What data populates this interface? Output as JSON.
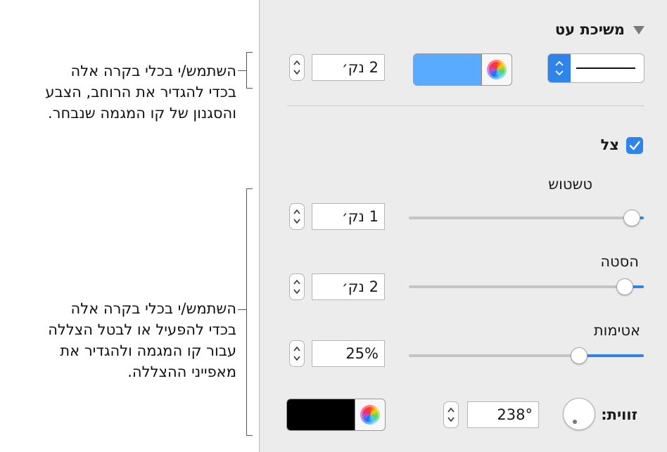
{
  "callouts": {
    "top": [
      "השתמש/י בכלי בקרה אלה",
      "בכדי להגדיר את הרוחב, הצבע",
      "והסגנון של קו המגמה שנבחר."
    ],
    "bottom": [
      "השתמש/י בכלי בקרה אלה",
      "בכדי להפעיל או לבטל הצללה",
      "עבור קו המגמה ולהגדיר את",
      "מאפייני ההצללה."
    ]
  },
  "stroke": {
    "title": "משיכת עט",
    "width_value": "2 נק׳",
    "color": "#59abff"
  },
  "shadow": {
    "label": "צל",
    "checked": true,
    "blur": {
      "label": "טשטוש",
      "value": "1 נק׳",
      "level": 1.0
    },
    "offset": {
      "label": "הסטה",
      "value": "2 נק׳",
      "level": 0.93
    },
    "opacity": {
      "label": "אטימות",
      "value": "25%",
      "level": 0.25
    },
    "angle": {
      "label": "זווית:",
      "value": "238°"
    },
    "color": "#000000"
  },
  "colors": {
    "accent": "#2f84ec",
    "panel_bg": "#ececec"
  }
}
